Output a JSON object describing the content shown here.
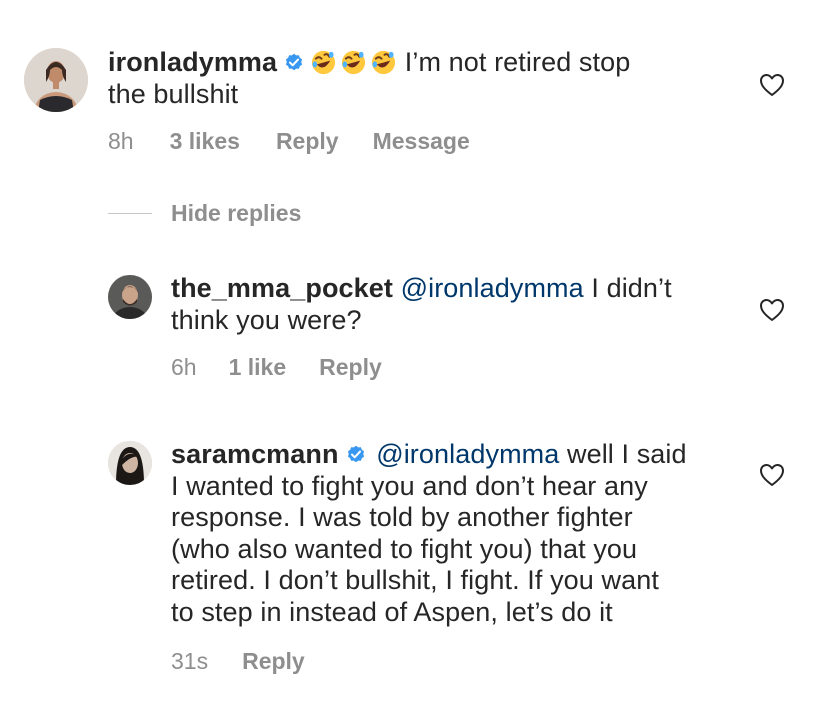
{
  "comments": [
    {
      "username": "ironladymma",
      "verified": true,
      "emojis": [
        "rolling-laughing-emoji",
        "rolling-laughing-emoji",
        "rolling-laughing-emoji"
      ],
      "text_line1": " I’m not retired stop",
      "text_line2": "the bullshit",
      "time": "8h",
      "likes": "3 likes",
      "reply_label": "Reply",
      "message_label": "Message"
    }
  ],
  "hide_replies_label": "Hide replies",
  "replies": [
    {
      "username": "the_mma_pocket",
      "mention": "@ironladymma",
      "text_line1": " I didn’t",
      "text_line2": "think you were?",
      "time": "6h",
      "likes": "1 like",
      "reply_label": "Reply"
    },
    {
      "username": "saramcmann",
      "verified": true,
      "mention": "@ironladymma",
      "text_line1": " well I said",
      "lines": [
        "I wanted to fight you and don’t hear any",
        "response. I was told by another fighter",
        "(who also wanted to fight you) that you",
        "retired. I don’t bullshit, I fight. If you want",
        "to step in instead of Aspen, let’s do it"
      ],
      "time": "31s",
      "reply_label": "Reply"
    }
  ],
  "colors": {
    "text": "#262626",
    "secondary": "#8e8e8e",
    "mention": "#00376b",
    "verified": "#3897f0"
  },
  "icons": {
    "like": "heart-outline-icon",
    "verified": "verified-badge-icon"
  }
}
